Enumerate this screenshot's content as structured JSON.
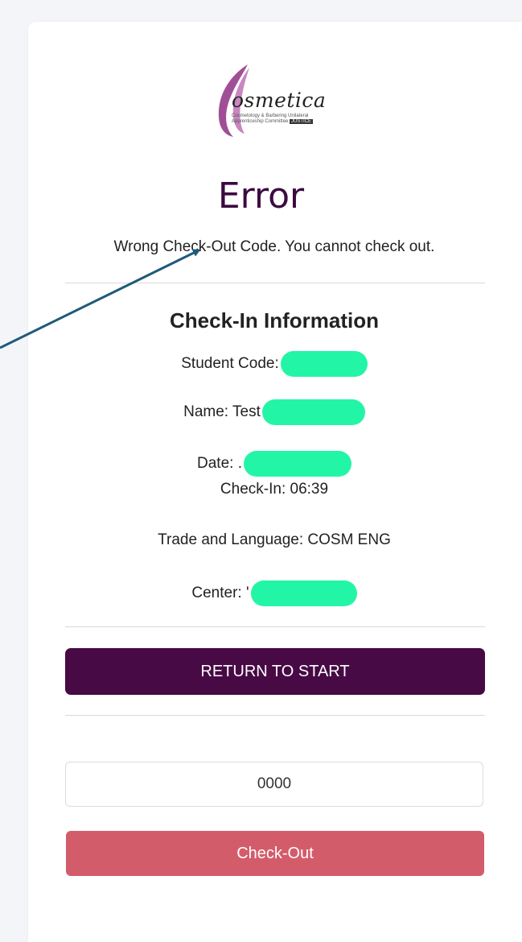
{
  "logo": {
    "brand_name": "osmetica",
    "subtitle_line1": "Cosmetology & Barbering Unilateral",
    "subtitle_line2": "Apprenticeship Committee",
    "badge": "JUSTICE"
  },
  "status": {
    "title": "Error",
    "message": "Wrong Check-Out Code. You cannot check out."
  },
  "checkin": {
    "section_title": "Check-In Information",
    "student_code_label": "Student Code:",
    "name_label": "Name: Test",
    "date_label": "Date: .",
    "checkin_time": "Check-In: 06:39",
    "trade_language": "Trade and Language: COSM ENG",
    "center_label": "Center: '"
  },
  "actions": {
    "return_label": "RETURN TO START",
    "code_value": "0000",
    "checkout_label": "Check-Out"
  },
  "colors": {
    "title": "#3b0b3f",
    "return_button": "#470a45",
    "checkout_button": "#d35c6b",
    "redaction": "#23f5a6",
    "arrow": "#1f5a7a"
  }
}
